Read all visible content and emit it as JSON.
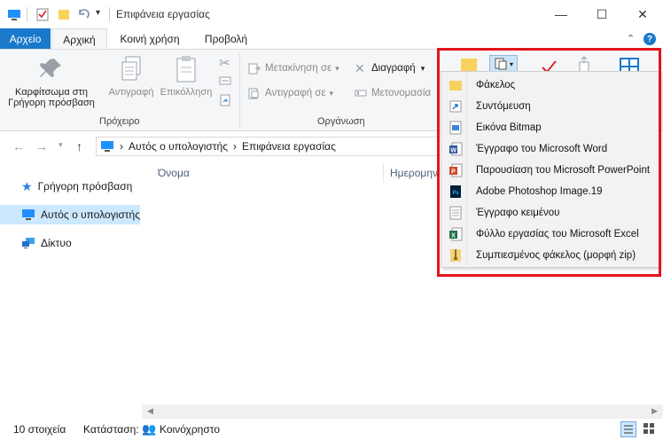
{
  "window": {
    "title": "Επιφάνεια εργασίας",
    "controls": {
      "minimize": "—",
      "maximize": "☐",
      "close": "✕"
    }
  },
  "tabs": {
    "file": "Αρχείο",
    "home": "Αρχική",
    "share": "Κοινή χρήση",
    "view": "Προβολή"
  },
  "ribbon": {
    "pin_label_line1": "Καρφίτσωμα στη",
    "pin_label_line2": "Γρήγορη πρόσβαση",
    "copy": "Αντιγραφή",
    "paste": "Επικόλληση",
    "clipboard_group": "Πρόχειρο",
    "move_to": "Μετακίνηση σε",
    "copy_to": "Αντιγραφή σε",
    "delete": "Διαγραφή",
    "rename": "Μετονομασία",
    "organize_group": "Οργάνωση"
  },
  "address": {
    "pc": "Αυτός ο υπολογιστής",
    "desktop": "Επιφάνεια εργασίας",
    "sep": "›"
  },
  "nav": {
    "quick_access": "Γρήγορη πρόσβαση",
    "this_pc": "Αυτός ο υπολογιστής",
    "network": "Δίκτυο"
  },
  "columns": {
    "name": "Όνομα",
    "date": "Ημερομηνία"
  },
  "status": {
    "count": "10 στοιχεία",
    "state_label": "Κατάσταση:",
    "state_value": "Κοινόχρηστο"
  },
  "new_menu": {
    "items": [
      {
        "label": "Φάκελος",
        "icon": "folder-icon"
      },
      {
        "label": "Συντόμευση",
        "icon": "shortcut-icon"
      },
      {
        "label": "Εικόνα Bitmap",
        "icon": "bitmap-icon"
      },
      {
        "label": "Έγγραφο του Microsoft Word",
        "icon": "word-icon"
      },
      {
        "label": "Παρουσίαση του Microsoft PowerPoint",
        "icon": "powerpoint-icon"
      },
      {
        "label": "Adobe Photoshop Image.19",
        "icon": "photoshop-icon"
      },
      {
        "label": "Έγγραφο κειμένου",
        "icon": "text-document-icon"
      },
      {
        "label": "Φύλλο εργασίας του Microsoft Excel",
        "icon": "excel-icon"
      },
      {
        "label": "Συμπιεσμένος φάκελος (μορφή zip)",
        "icon": "zip-folder-icon"
      }
    ]
  },
  "colors": {
    "accent": "#1979ca",
    "highlight": "#e3141b",
    "selection": "#cce8ff"
  }
}
